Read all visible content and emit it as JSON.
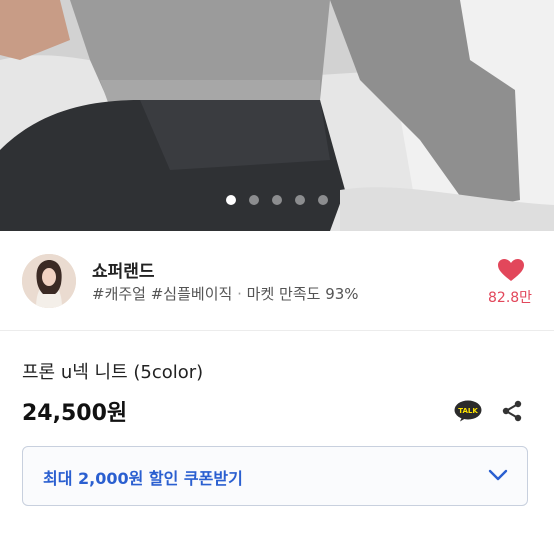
{
  "carousel": {
    "slide_count": 5,
    "active_index": 0
  },
  "shop": {
    "name": "쇼퍼랜드",
    "tags": "#캐주얼 #심플베이직",
    "separator": "·",
    "satisfaction": "마켓 만족도 93%",
    "likes": "82.8만"
  },
  "product": {
    "title": "프론 u넥 니트 (5color)",
    "price": "24,500원",
    "talk_label": "TALK"
  },
  "coupon": {
    "label": "최대 2,000원 할인 쿠폰받기"
  },
  "colors": {
    "accent_blue": "#2a5fd0",
    "heart_red": "#e2475b",
    "kakao_yellow": "#fee500"
  }
}
